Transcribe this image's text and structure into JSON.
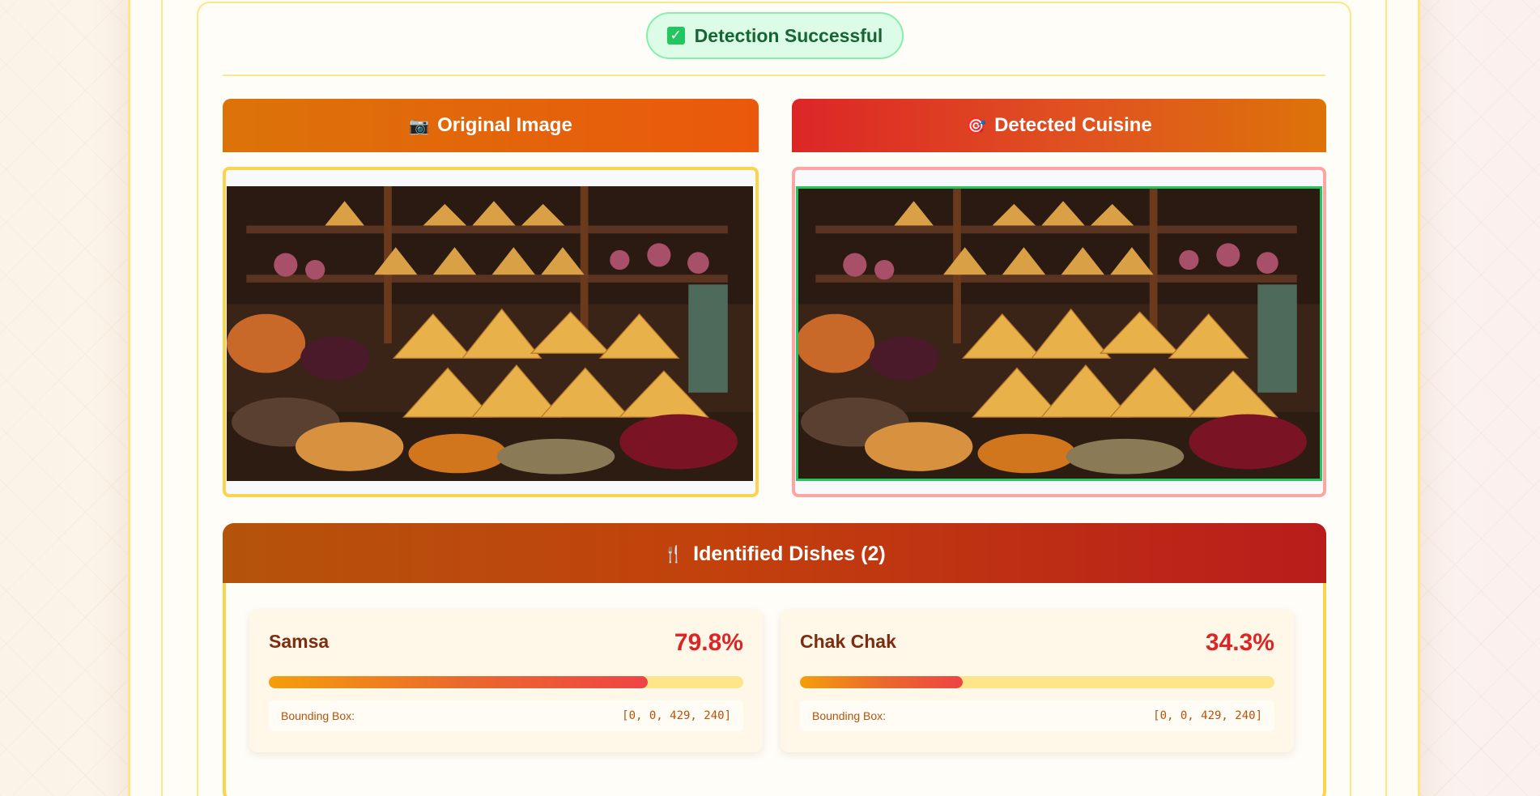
{
  "status": {
    "text": "Detection Successful",
    "icon": "check-mark-icon"
  },
  "panels": {
    "original": {
      "title": "Original Image",
      "icon": "camera-icon",
      "icon_glyph": "📷"
    },
    "detected": {
      "title": "Detected Cuisine",
      "icon": "target-icon",
      "icon_glyph": "🎯"
    }
  },
  "dishes": {
    "title": "Identified Dishes (2)",
    "icon": "fork-knife-icon",
    "icon_glyph": "🍴",
    "items": [
      {
        "name": "Samsa",
        "score": "79.8%",
        "progress": 0.798,
        "bbox_label": "Bounding Box:",
        "bbox_value": "[0, 0, 429, 240]"
      },
      {
        "name": "Chak Chak",
        "score": "34.3%",
        "progress": 0.343,
        "bbox_label": "Bounding Box:",
        "bbox_value": "[0, 0, 429, 240]"
      }
    ]
  },
  "colors": {
    "success_bg": "#dcfce7",
    "success_text": "#166534",
    "score_red": "#dc2626",
    "bbox_green": "#22c55e",
    "accent_orange": "#ea580c"
  }
}
